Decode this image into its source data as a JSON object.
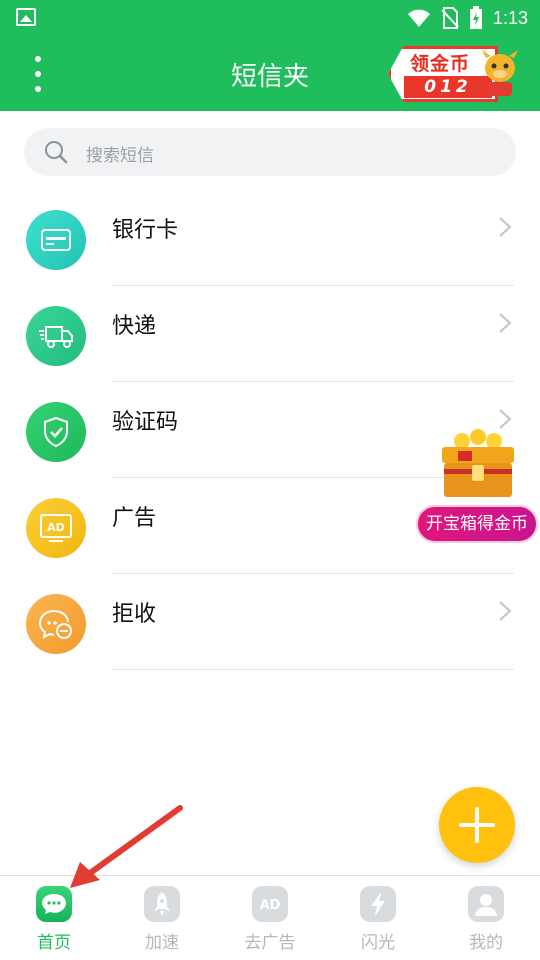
{
  "status_bar": {
    "time": "1:13"
  },
  "app_bar": {
    "title": "短信夹",
    "coin_badge": {
      "label": "领金币",
      "count": "012"
    }
  },
  "search": {
    "placeholder": "搜索短信"
  },
  "categories": [
    {
      "label": "银行卡",
      "icon": "bank-card-icon",
      "color": "#2fd3c0"
    },
    {
      "label": "快递",
      "icon": "delivery-truck-icon",
      "color": "#2cc98a"
    },
    {
      "label": "验证码",
      "icon": "shield-check-icon",
      "color": "#27c465"
    },
    {
      "label": "广告",
      "icon": "ad-icon",
      "color": "#f6c31f"
    },
    {
      "label": "拒收",
      "icon": "blocked-chat-icon",
      "color": "#f7a540"
    }
  ],
  "treasure": {
    "label": "开宝箱得金币"
  },
  "tabs": [
    {
      "label": "首页",
      "icon": "chat-bubble-icon",
      "active": true
    },
    {
      "label": "加速",
      "icon": "rocket-icon",
      "active": false
    },
    {
      "label": "去广告",
      "icon": "ad-icon",
      "active": false
    },
    {
      "label": "闪光",
      "icon": "lightning-icon",
      "active": false
    },
    {
      "label": "我的",
      "icon": "person-icon",
      "active": false
    }
  ],
  "colors": {
    "brand": "#1fbd5b",
    "fab": "#ffc10e",
    "annotation": "#e23b32"
  }
}
